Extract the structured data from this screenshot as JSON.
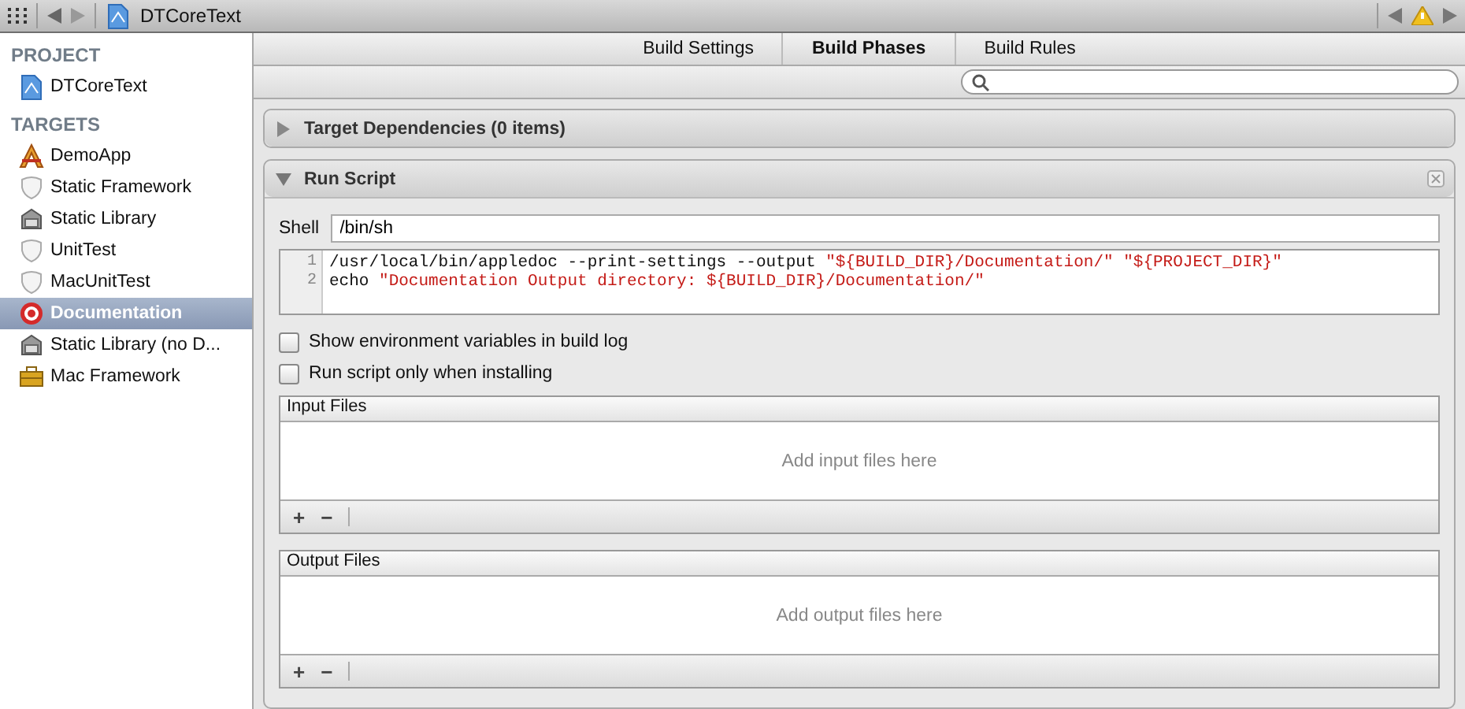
{
  "toolbar": {
    "path": "DTCoreText"
  },
  "sidebar": [
    {
      "heading": "PROJECT",
      "items": [
        {
          "label": "DTCoreText",
          "kind": "project",
          "selected": false
        }
      ]
    },
    {
      "heading": "TARGETS",
      "items": [
        {
          "label": "DemoApp",
          "kind": "app",
          "selected": false
        },
        {
          "label": "Static Framework",
          "kind": "framework",
          "selected": false
        },
        {
          "label": "Static Library",
          "kind": "library",
          "selected": false
        },
        {
          "label": "UnitTest",
          "kind": "framework",
          "selected": false
        },
        {
          "label": "MacUnitTest",
          "kind": "framework",
          "selected": false
        },
        {
          "label": "Documentation",
          "kind": "aggregate",
          "selected": true
        },
        {
          "label": "Static Library (no D...",
          "kind": "library",
          "selected": false
        },
        {
          "label": "Mac Framework",
          "kind": "toolbox",
          "selected": false
        }
      ]
    }
  ],
  "tabs": [
    {
      "label": "Build Settings",
      "selected": false
    },
    {
      "label": "Build Phases",
      "selected": true
    },
    {
      "label": "Build Rules",
      "selected": false
    }
  ],
  "phases": [
    {
      "title": "Target Dependencies (0 items)",
      "expanded": false
    },
    {
      "title": "Run Script",
      "expanded": true,
      "shell_label": "Shell",
      "shell": "/bin/sh",
      "script": [
        {
          "number": "1",
          "parts": [
            {
              "text": "/usr/local/bin/appledoc --print-settings --output ",
              "kind": "plain"
            },
            {
              "text": "\"${BUILD_DIR}/Documentation/\" \"${PROJECT_DIR}\"",
              "kind": "string"
            }
          ]
        },
        {
          "number": "2",
          "parts": [
            {
              "text": "echo ",
              "kind": "plain"
            },
            {
              "text": "\"Documentation Output directory: ${BUILD_DIR}/Documentation/\"",
              "kind": "string"
            }
          ]
        }
      ],
      "options": [
        {
          "label": "Show environment variables in build log",
          "checked": false
        },
        {
          "label": "Run script only when installing",
          "checked": false
        }
      ],
      "lists": [
        {
          "title": "Input Files",
          "placeholder": "Add input files here",
          "add": "+",
          "remove": "−"
        },
        {
          "title": "Output Files",
          "placeholder": "Add output files here",
          "add": "+",
          "remove": "−"
        }
      ]
    }
  ]
}
